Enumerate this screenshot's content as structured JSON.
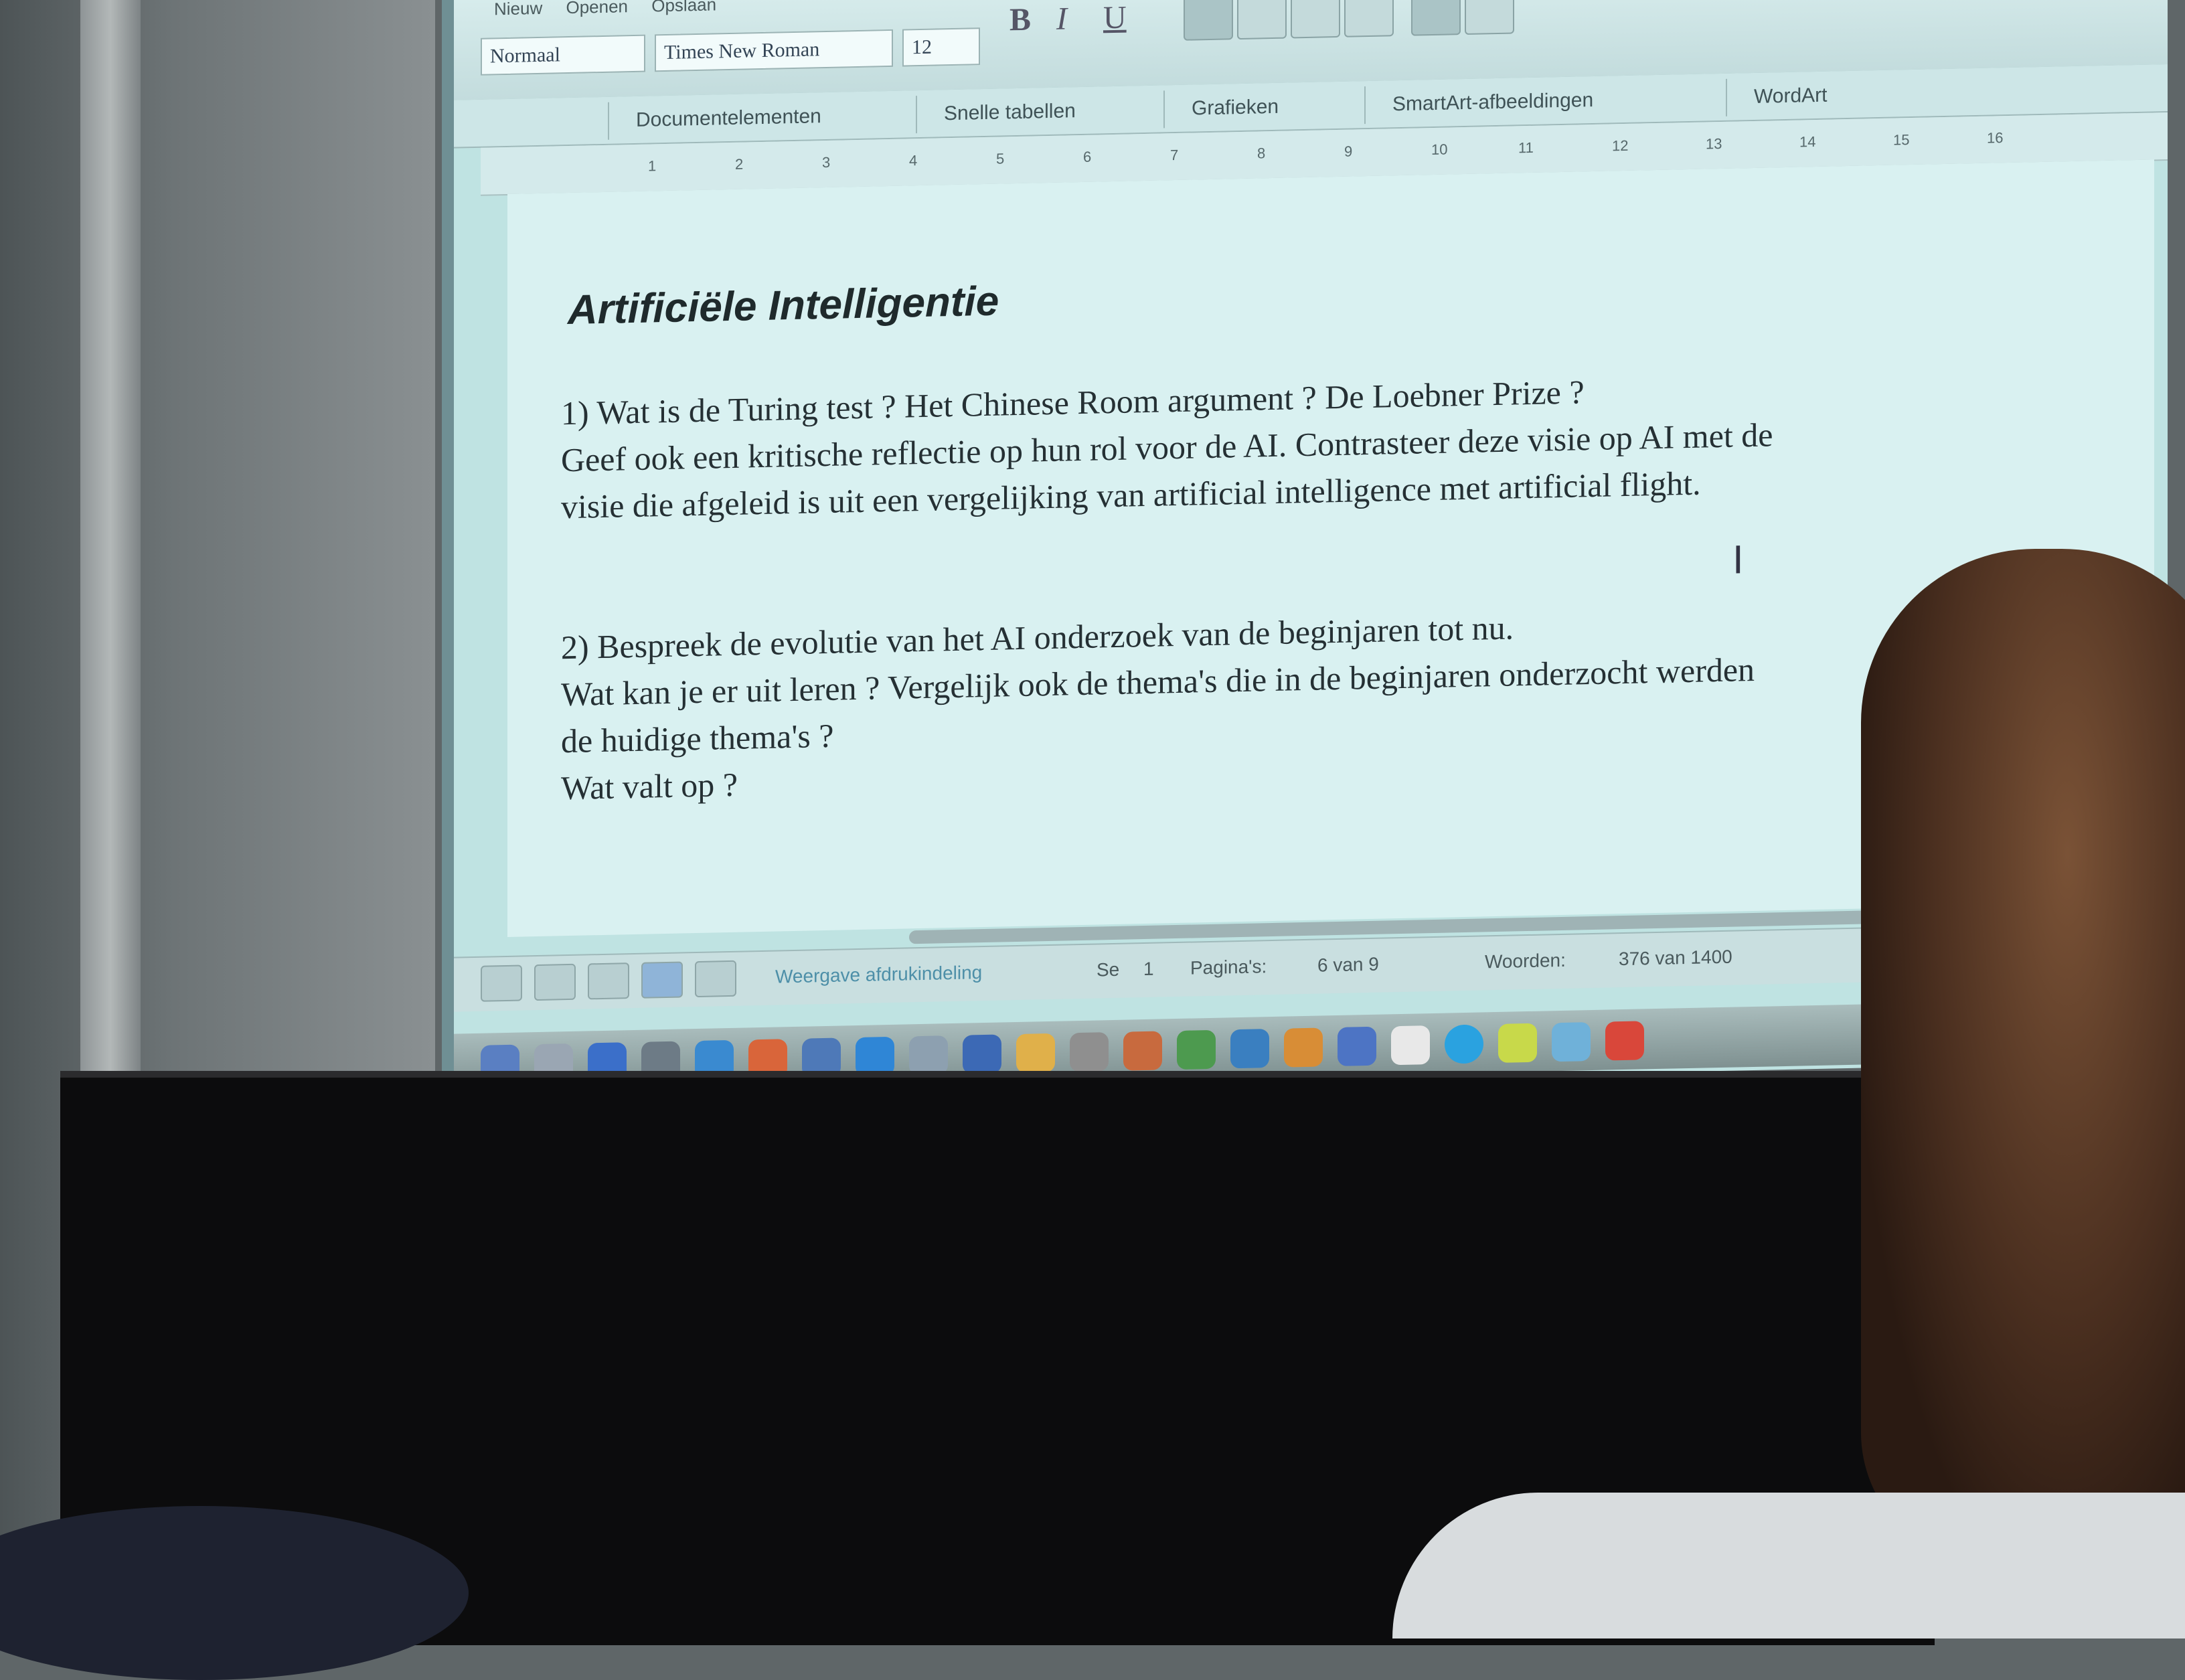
{
  "app": {
    "menu": [
      "Nieuw",
      "Openen",
      "Opslaan"
    ],
    "style_name": "Normaal",
    "font_name": "Times New Roman",
    "font_size": "12",
    "format_buttons": {
      "bold": "B",
      "italic": "I",
      "underline": "U"
    }
  },
  "ribbon_tabs": [
    "Documentelementen",
    "Snelle tabellen",
    "Grafieken",
    "SmartArt-afbeeldingen",
    "WordArt"
  ],
  "ruler_marks": [
    "1",
    "2",
    "3",
    "4",
    "5",
    "6",
    "7",
    "8",
    "9",
    "10",
    "11",
    "12",
    "13",
    "14",
    "15",
    "16"
  ],
  "document": {
    "title": "Artificiële Intelligentie",
    "q1": [
      "1) Wat is de Turing test ? Het Chinese Room argument ? De Loebner Prize ?",
      "Geef ook een kritische reflectie op hun rol voor de AI.    Contrasteer deze visie op AI met de",
      "visie die afgeleid is uit een vergelijking van artificial intelligence met artificial flight."
    ],
    "q2": [
      "2) Bespreek de evolutie van het AI onderzoek van de beginjaren tot nu.",
      "Wat kan je er uit leren ? Vergelijk ook de thema's die in de beginjaren onderzocht werden",
      "de huidige thema's ?",
      "Wat valt op ?"
    ]
  },
  "status": {
    "view": "Weergave afdrukindeling",
    "section_label": "Se",
    "section_value": "1",
    "pages_label": "Pagina's:",
    "pages_value": "6 van 9",
    "words_label": "Woorden:",
    "words_value": "376 van 1400"
  }
}
